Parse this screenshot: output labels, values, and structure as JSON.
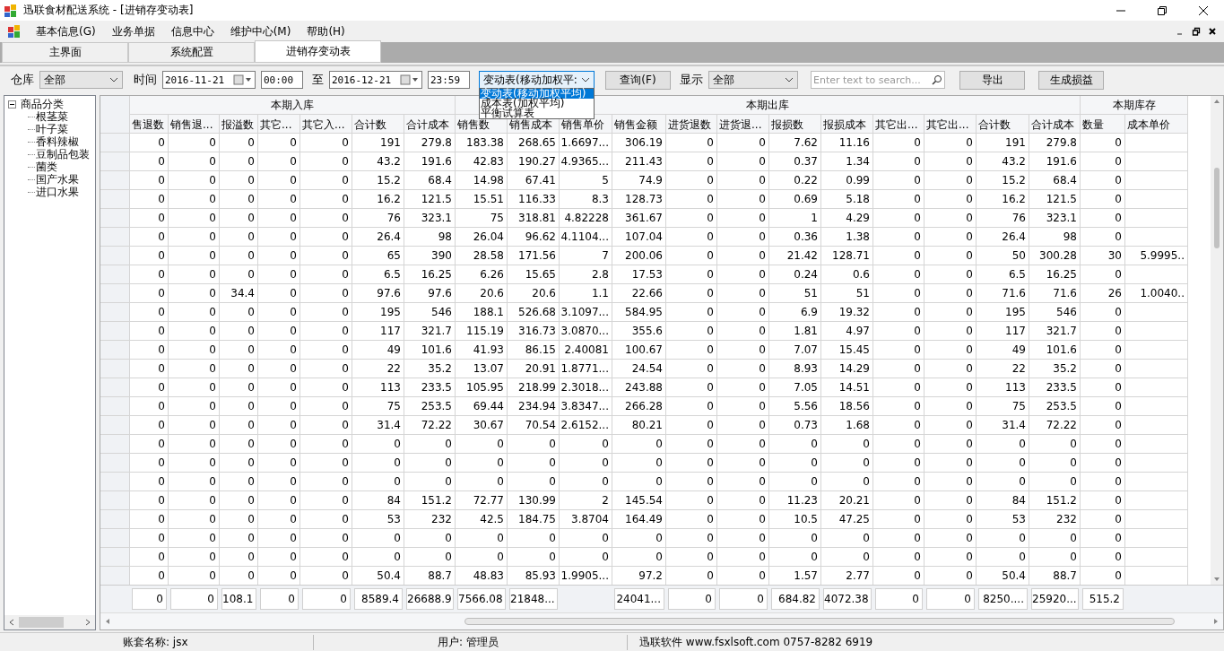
{
  "window": {
    "title": "迅联食材配送系统 - [进销存变动表]"
  },
  "menu": [
    "基本信息(G)",
    "业务单据",
    "信息中心",
    "维护中心(M)",
    "帮助(H)"
  ],
  "tabs": [
    {
      "label": "主界面",
      "selected": false
    },
    {
      "label": "系统配置",
      "selected": false
    },
    {
      "label": "进销存变动表",
      "selected": true
    }
  ],
  "toolbar": {
    "warehouse_label": "仓库",
    "warehouse": "全部",
    "time_label": "时间",
    "date_from": "2016-11-21",
    "time_from": "00:00",
    "to_label": "至",
    "date_to": "2016-12-21",
    "time_to": "23:59",
    "report_type": "变动表(移动加权平:",
    "report_options": [
      {
        "label": "变动表(移动加权平均)",
        "selected": true
      },
      {
        "label": "成本表(加权平均)",
        "selected": false
      },
      {
        "label": "平衡试算表",
        "selected": false
      }
    ],
    "query_button": "查询(F)",
    "show_label": "显示",
    "show": "全部",
    "search": {
      "placeholder": "Enter text to search..."
    },
    "export_button": "导出",
    "loss_button": "生成损益"
  },
  "tree": {
    "label": "商品分类",
    "expanded": true,
    "children": [
      {
        "label": "根茎菜"
      },
      {
        "label": "叶子菜"
      },
      {
        "label": "香料辣椒"
      },
      {
        "label": "豆制品包装"
      },
      {
        "label": "菌类"
      },
      {
        "label": "国产水果"
      },
      {
        "label": "进口水果"
      }
    ]
  },
  "table": {
    "groups": [
      "本期入库",
      "本期出库",
      "本期库存"
    ],
    "columns": [
      "售退数",
      "销售退...",
      "报溢数",
      "其它...",
      "其它入...",
      "合计数",
      "合计成本",
      "销售数",
      "销售成本",
      "销售单价",
      "销售金额",
      "进货退数",
      "进货退...",
      "报损数",
      "报损成本",
      "其它出...",
      "其它出...",
      "合计数",
      "合计成本",
      "数量",
      "成本单价"
    ],
    "rows": [
      [
        "0",
        "0",
        "0",
        "0",
        "0",
        "191",
        "279.8",
        "183.38",
        "268.65",
        "1.6697...",
        "306.19",
        "0",
        "0",
        "7.62",
        "11.16",
        "0",
        "0",
        "191",
        "279.8",
        "0"
      ],
      [
        "0",
        "0",
        "0",
        "0",
        "0",
        "43.2",
        "191.6",
        "42.83",
        "190.27",
        "4.9365...",
        "211.43",
        "0",
        "0",
        "0.37",
        "1.34",
        "0",
        "0",
        "43.2",
        "191.6",
        "0"
      ],
      [
        "0",
        "0",
        "0",
        "0",
        "0",
        "15.2",
        "68.4",
        "14.98",
        "67.41",
        "5",
        "74.9",
        "0",
        "0",
        "0.22",
        "0.99",
        "0",
        "0",
        "15.2",
        "68.4",
        "0"
      ],
      [
        "0",
        "0",
        "0",
        "0",
        "0",
        "16.2",
        "121.5",
        "15.51",
        "116.33",
        "8.3",
        "128.73",
        "0",
        "0",
        "0.69",
        "5.18",
        "0",
        "0",
        "16.2",
        "121.5",
        "0"
      ],
      [
        "0",
        "0",
        "0",
        "0",
        "0",
        "76",
        "323.1",
        "75",
        "318.81",
        "4.82228",
        "361.67",
        "0",
        "0",
        "1",
        "4.29",
        "0",
        "0",
        "76",
        "323.1",
        "0"
      ],
      [
        "0",
        "0",
        "0",
        "0",
        "0",
        "26.4",
        "98",
        "26.04",
        "96.62",
        "4.1104...",
        "107.04",
        "0",
        "0",
        "0.36",
        "1.38",
        "0",
        "0",
        "26.4",
        "98",
        "0"
      ],
      [
        "0",
        "0",
        "0",
        "0",
        "0",
        "65",
        "390",
        "28.58",
        "171.56",
        "7",
        "200.06",
        "0",
        "0",
        "21.42",
        "128.71",
        "0",
        "0",
        "50",
        "300.28",
        "30",
        "5.9995.."
      ],
      [
        "0",
        "0",
        "0",
        "0",
        "0",
        "6.5",
        "16.25",
        "6.26",
        "15.65",
        "2.8",
        "17.53",
        "0",
        "0",
        "0.24",
        "0.6",
        "0",
        "0",
        "6.5",
        "16.25",
        "0"
      ],
      [
        "0",
        "0",
        "34.4",
        "0",
        "0",
        "97.6",
        "97.6",
        "20.6",
        "20.6",
        "1.1",
        "22.66",
        "0",
        "0",
        "51",
        "51",
        "0",
        "0",
        "71.6",
        "71.6",
        "26",
        "1.0040.."
      ],
      [
        "0",
        "0",
        "0",
        "0",
        "0",
        "195",
        "546",
        "188.1",
        "526.68",
        "3.1097...",
        "584.95",
        "0",
        "0",
        "6.9",
        "19.32",
        "0",
        "0",
        "195",
        "546",
        "0"
      ],
      [
        "0",
        "0",
        "0",
        "0",
        "0",
        "117",
        "321.7",
        "115.19",
        "316.73",
        "3.0870...",
        "355.6",
        "0",
        "0",
        "1.81",
        "4.97",
        "0",
        "0",
        "117",
        "321.7",
        "0"
      ],
      [
        "0",
        "0",
        "0",
        "0",
        "0",
        "49",
        "101.6",
        "41.93",
        "86.15",
        "2.40081",
        "100.67",
        "0",
        "0",
        "7.07",
        "15.45",
        "0",
        "0",
        "49",
        "101.6",
        "0"
      ],
      [
        "0",
        "0",
        "0",
        "0",
        "0",
        "22",
        "35.2",
        "13.07",
        "20.91",
        "1.8771...",
        "24.54",
        "0",
        "0",
        "8.93",
        "14.29",
        "0",
        "0",
        "22",
        "35.2",
        "0"
      ],
      [
        "0",
        "0",
        "0",
        "0",
        "0",
        "113",
        "233.5",
        "105.95",
        "218.99",
        "2.3018...",
        "243.88",
        "0",
        "0",
        "7.05",
        "14.51",
        "0",
        "0",
        "113",
        "233.5",
        "0"
      ],
      [
        "0",
        "0",
        "0",
        "0",
        "0",
        "75",
        "253.5",
        "69.44",
        "234.94",
        "3.8347...",
        "266.28",
        "0",
        "0",
        "5.56",
        "18.56",
        "0",
        "0",
        "75",
        "253.5",
        "0"
      ],
      [
        "0",
        "0",
        "0",
        "0",
        "0",
        "31.4",
        "72.22",
        "30.67",
        "70.54",
        "2.6152...",
        "80.21",
        "0",
        "0",
        "0.73",
        "1.68",
        "0",
        "0",
        "31.4",
        "72.22",
        "0"
      ],
      [
        "0",
        "0",
        "0",
        "0",
        "0",
        "0",
        "0",
        "0",
        "0",
        "0",
        "0",
        "0",
        "0",
        "0",
        "0",
        "0",
        "0",
        "0",
        "0",
        "0"
      ],
      [
        "0",
        "0",
        "0",
        "0",
        "0",
        "0",
        "0",
        "0",
        "0",
        "0",
        "0",
        "0",
        "0",
        "0",
        "0",
        "0",
        "0",
        "0",
        "0",
        "0"
      ],
      [
        "0",
        "0",
        "0",
        "0",
        "0",
        "0",
        "0",
        "0",
        "0",
        "0",
        "0",
        "0",
        "0",
        "0",
        "0",
        "0",
        "0",
        "0",
        "0",
        "0"
      ],
      [
        "0",
        "0",
        "0",
        "0",
        "0",
        "84",
        "151.2",
        "72.77",
        "130.99",
        "2",
        "145.54",
        "0",
        "0",
        "11.23",
        "20.21",
        "0",
        "0",
        "84",
        "151.2",
        "0"
      ],
      [
        "0",
        "0",
        "0",
        "0",
        "0",
        "53",
        "232",
        "42.5",
        "184.75",
        "3.8704",
        "164.49",
        "0",
        "0",
        "10.5",
        "47.25",
        "0",
        "0",
        "53",
        "232",
        "0"
      ],
      [
        "0",
        "0",
        "0",
        "0",
        "0",
        "0",
        "0",
        "0",
        "0",
        "0",
        "0",
        "0",
        "0",
        "0",
        "0",
        "0",
        "0",
        "0",
        "0",
        "0"
      ],
      [
        "0",
        "0",
        "0",
        "0",
        "0",
        "0",
        "0",
        "0",
        "0",
        "0",
        "0",
        "0",
        "0",
        "0",
        "0",
        "0",
        "0",
        "0",
        "0",
        "0"
      ],
      [
        "0",
        "0",
        "0",
        "0",
        "0",
        "50.4",
        "88.7",
        "48.83",
        "85.93",
        "1.9905...",
        "97.2",
        "0",
        "0",
        "1.57",
        "2.77",
        "0",
        "0",
        "50.4",
        "88.7",
        "0"
      ]
    ],
    "totals": [
      "0",
      "0",
      "108.1",
      "0",
      "0",
      "8589.4",
      "26688.9",
      "7566.08",
      "21848...",
      "24041...",
      "0",
      "0",
      "684.82",
      "4072.38",
      "0",
      "0",
      "8250....",
      "25920...",
      "515.2"
    ]
  },
  "status_bar": {
    "account": "账套名称:  jsx",
    "user": "用户:  管理员",
    "company": "迅联软件  www.fsxlsoft.com 0757-8282 6919"
  }
}
